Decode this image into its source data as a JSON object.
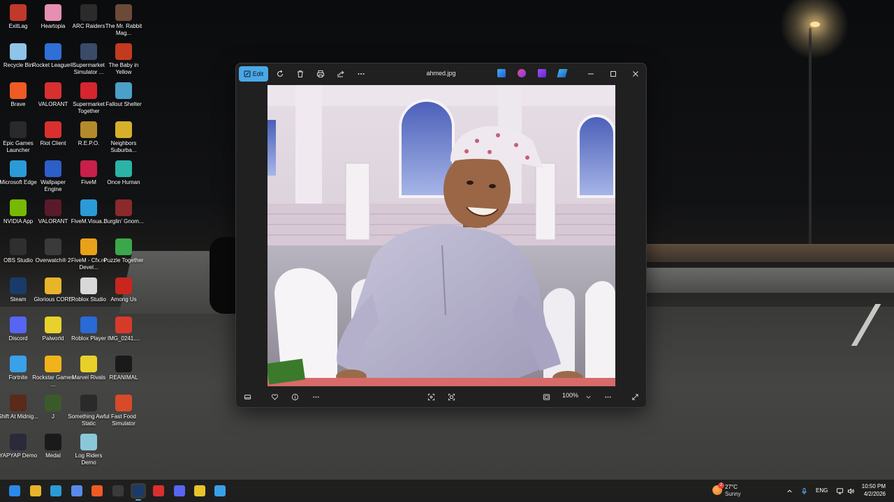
{
  "desktop": {
    "icons": [
      {
        "label": "ExitLag",
        "icon": "exitlag-icon",
        "color": "#c0392b"
      },
      {
        "label": "Heartopia",
        "icon": "heartopia-icon",
        "color": "#e58fb3"
      },
      {
        "label": "ARC Raiders",
        "icon": "arc-raiders-icon",
        "color": "#2b2b2b"
      },
      {
        "label": "The Mr. Rabbit Mag...",
        "icon": "mr-rabbit-icon",
        "color": "#6b4a3a"
      },
      {
        "label": "Recycle Bin",
        "icon": "recycle-bin-icon",
        "color": "#8fc3e8"
      },
      {
        "label": "Rocket League®",
        "icon": "rocket-league-icon",
        "color": "#2f6fd6"
      },
      {
        "label": "Supermarket Simulator ...",
        "icon": "supermarket-simulator-icon",
        "color": "#3b4a66"
      },
      {
        "label": "The Baby in Yellow",
        "icon": "baby-in-yellow-icon",
        "color": "#c23b1f"
      },
      {
        "label": "Brave",
        "icon": "brave-icon",
        "color": "#f05a24"
      },
      {
        "label": "VALORANT",
        "icon": "valorant-icon",
        "color": "#d8302f"
      },
      {
        "label": "Supermarket Together",
        "icon": "supermarket-together-icon",
        "color": "#d6252f"
      },
      {
        "label": "Fallout Shelter",
        "icon": "fallout-shelter-icon",
        "color": "#4aa0c8"
      },
      {
        "label": "Epic Games Launcher",
        "icon": "epic-games-icon",
        "color": "#2a2a2a"
      },
      {
        "label": "Riot Client",
        "icon": "riot-client-icon",
        "color": "#d8302f"
      },
      {
        "label": "R.E.P.O.",
        "icon": "repo-icon",
        "color": "#b58a2a"
      },
      {
        "label": "Neighbors Suburba...",
        "icon": "neighbors-icon",
        "color": "#d6b02a"
      },
      {
        "label": "Microsoft Edge",
        "icon": "edge-icon",
        "color": "#2a9bd6"
      },
      {
        "label": "Wallpaper Engine",
        "icon": "wallpaper-engine-icon",
        "color": "#2d5fc8"
      },
      {
        "label": "FiveM",
        "icon": "fivem-icon",
        "color": "#c8204a"
      },
      {
        "label": "Once Human",
        "icon": "once-human-icon",
        "color": "#2bb3a8"
      },
      {
        "label": "NVIDIA App",
        "icon": "nvidia-icon",
        "color": "#76b900"
      },
      {
        "label": "VALORANT",
        "icon": "valorant-icon",
        "color": "#5a1a2a"
      },
      {
        "label": "FiveM.Visua...",
        "icon": "fivem-visual-icon",
        "color": "#2a9bd6"
      },
      {
        "label": "Burglin' Gnom...",
        "icon": "burglin-gnomes-icon",
        "color": "#8a2a2a"
      },
      {
        "label": "OBS Studio",
        "icon": "obs-icon",
        "color": "#2f2f2f"
      },
      {
        "label": "Overwatch® 2",
        "icon": "overwatch-icon",
        "color": "#3a3a3a"
      },
      {
        "label": "FiveM - Cfx.re Devel...",
        "icon": "cfx-icon",
        "color": "#e8a21a"
      },
      {
        "label": "Puzzle Together",
        "icon": "puzzle-together-icon",
        "color": "#3aa84a"
      },
      {
        "label": "Steam",
        "icon": "steam-icon",
        "color": "#1b3a6a"
      },
      {
        "label": "Glorious CORE",
        "icon": "glorious-icon",
        "color": "#e8b42a"
      },
      {
        "label": "Roblox Studio",
        "icon": "roblox-studio-icon",
        "color": "#d8d8d8"
      },
      {
        "label": "Among Us",
        "icon": "among-us-icon",
        "color": "#c8261f"
      },
      {
        "label": "Discord",
        "icon": "discord-icon",
        "color": "#5865f2"
      },
      {
        "label": "Palworld",
        "icon": "palworld-icon",
        "color": "#e8d12a"
      },
      {
        "label": "Roblox Player",
        "icon": "roblox-player-icon",
        "color": "#2a6ad6"
      },
      {
        "label": "IMG_0241....",
        "icon": "image-file-icon",
        "color": "#d83a2a"
      },
      {
        "label": "Fortnite",
        "icon": "fortnite-icon",
        "color": "#3aa0e8"
      },
      {
        "label": "Rockstar Games ...",
        "icon": "rockstar-icon",
        "color": "#f0b41a"
      },
      {
        "label": "Marvel Rivals",
        "icon": "marvel-rivals-icon",
        "color": "#e8d02a"
      },
      {
        "label": "REANIMAL",
        "icon": "reanimal-icon",
        "color": "#1a1a1a"
      },
      {
        "label": "Shift At Midnig...",
        "icon": "shift-at-midnight-icon",
        "color": "#5a2a1a"
      },
      {
        "label": "J",
        "icon": "j-icon",
        "color": "#3a5a2a"
      },
      {
        "label": "Something Awful Static",
        "icon": "something-awful-icon",
        "color": "#2a2a2a"
      },
      {
        "label": "Fast Food Simulator",
        "icon": "fast-food-icon",
        "color": "#d84a2a"
      },
      {
        "label": "YAPYAP Demo",
        "icon": "yapyap-icon",
        "color": "#2a2a3a"
      },
      {
        "label": "Medal",
        "icon": "medal-icon",
        "color": "#1a1a1a"
      },
      {
        "label": "Log Riders Demo",
        "icon": "log-riders-icon",
        "color": "#8ac8d8"
      }
    ]
  },
  "photos": {
    "title": "ahmed.jpg",
    "edit_label": "Edit",
    "zoom": "100%",
    "toolbar_icons": [
      "rotate-icon",
      "delete-icon",
      "print-icon",
      "share-icon",
      "more-icon"
    ],
    "app_icons": [
      "designer-icon",
      "clipchamp-icon",
      "app-icon-purple",
      "app-icon-blue"
    ]
  },
  "taskbar": {
    "apps": [
      {
        "name": "start-button",
        "color": "#2a8ae8"
      },
      {
        "name": "file-explorer-icon",
        "color": "#e8b42a"
      },
      {
        "name": "edge-icon",
        "color": "#2a9bd6"
      },
      {
        "name": "microsoft-store-icon",
        "color": "#5a8ae8"
      },
      {
        "name": "brave-icon",
        "color": "#f05a24"
      },
      {
        "name": "epic-games-icon",
        "color": "#3a3a3a"
      },
      {
        "name": "steam-icon",
        "color": "#1b3a6a"
      },
      {
        "name": "riot-client-icon",
        "color": "#d8302f"
      },
      {
        "name": "discord-icon",
        "color": "#5865f2"
      },
      {
        "name": "image-viewer-icon",
        "color": "#e8c42a"
      },
      {
        "name": "photos-icon",
        "color": "#3aa0e8"
      }
    ],
    "weather": {
      "temp": "27°C",
      "condition": "Sunny",
      "badge": "2"
    },
    "language": "ENG",
    "time": "10:50 PM",
    "date": "4/2/2026"
  }
}
